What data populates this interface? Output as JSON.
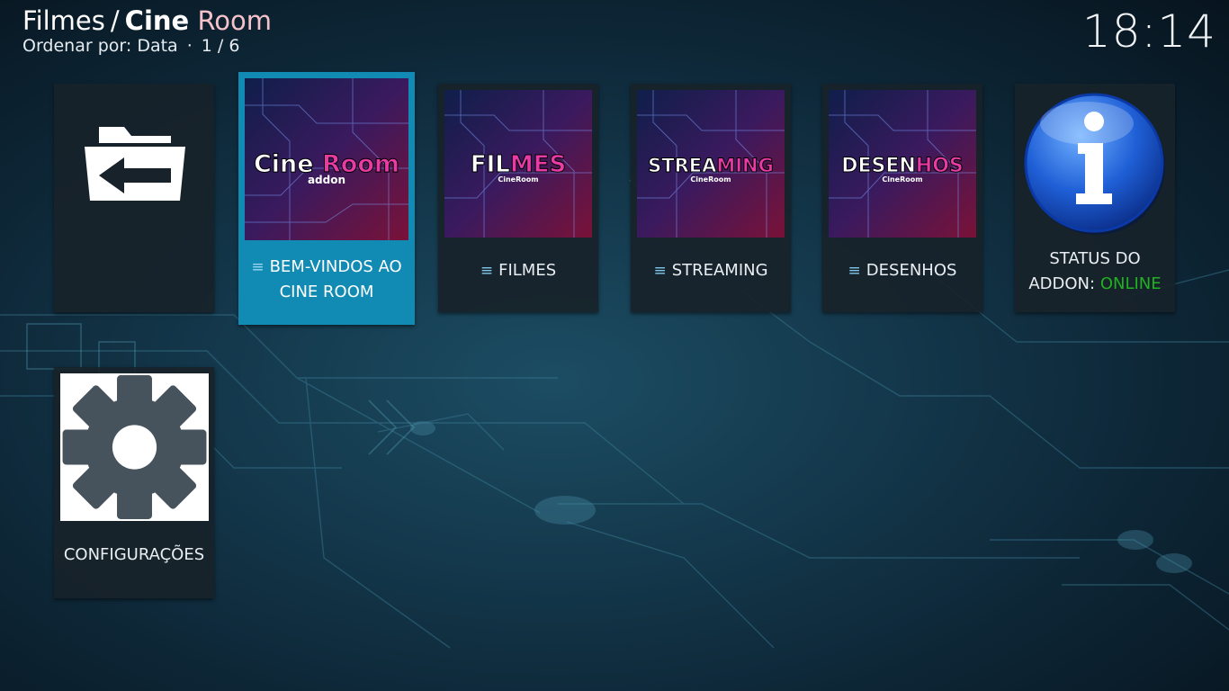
{
  "header": {
    "section": "Filmes",
    "separator": "/",
    "addon_name_first": "Cine",
    "addon_name_second": "Room",
    "sort_label": "Ordenar por: Data",
    "dot": "·",
    "position": "1 / 6",
    "clock": "18:14"
  },
  "items": [
    {
      "label": "",
      "icon": "folder-back-icon"
    },
    {
      "label_line1": "BEM-VINDOS AO",
      "label_line2": "CINE ROOM",
      "thumb_title_1": "Cine",
      "thumb_title_2": "Room",
      "thumb_sub": "addon",
      "focused": true
    },
    {
      "label": "FILMES",
      "thumb_title_1": "FIL",
      "thumb_title_2": "MES",
      "thumb_sub": "CineRoom"
    },
    {
      "label": "STREAMING",
      "thumb_title_1": "STREA",
      "thumb_title_2": "MING",
      "thumb_sub": "CineRoom"
    },
    {
      "label": "DESENHOS",
      "thumb_title_1": "DESEN",
      "thumb_title_2": "HOS",
      "thumb_sub": "CineRoom"
    },
    {
      "label_line1": "STATUS DO",
      "label_line2_prefix": "ADDON:",
      "label_line2_status": "ONLINE",
      "icon": "info-icon"
    },
    {
      "label": "CONFIGURAÇÕES",
      "icon": "gear-icon"
    }
  ],
  "colors": {
    "focus": "#128bb4",
    "online": "#21b021",
    "pink": "#e93aa6",
    "title_pink": "#f4c2c8"
  }
}
